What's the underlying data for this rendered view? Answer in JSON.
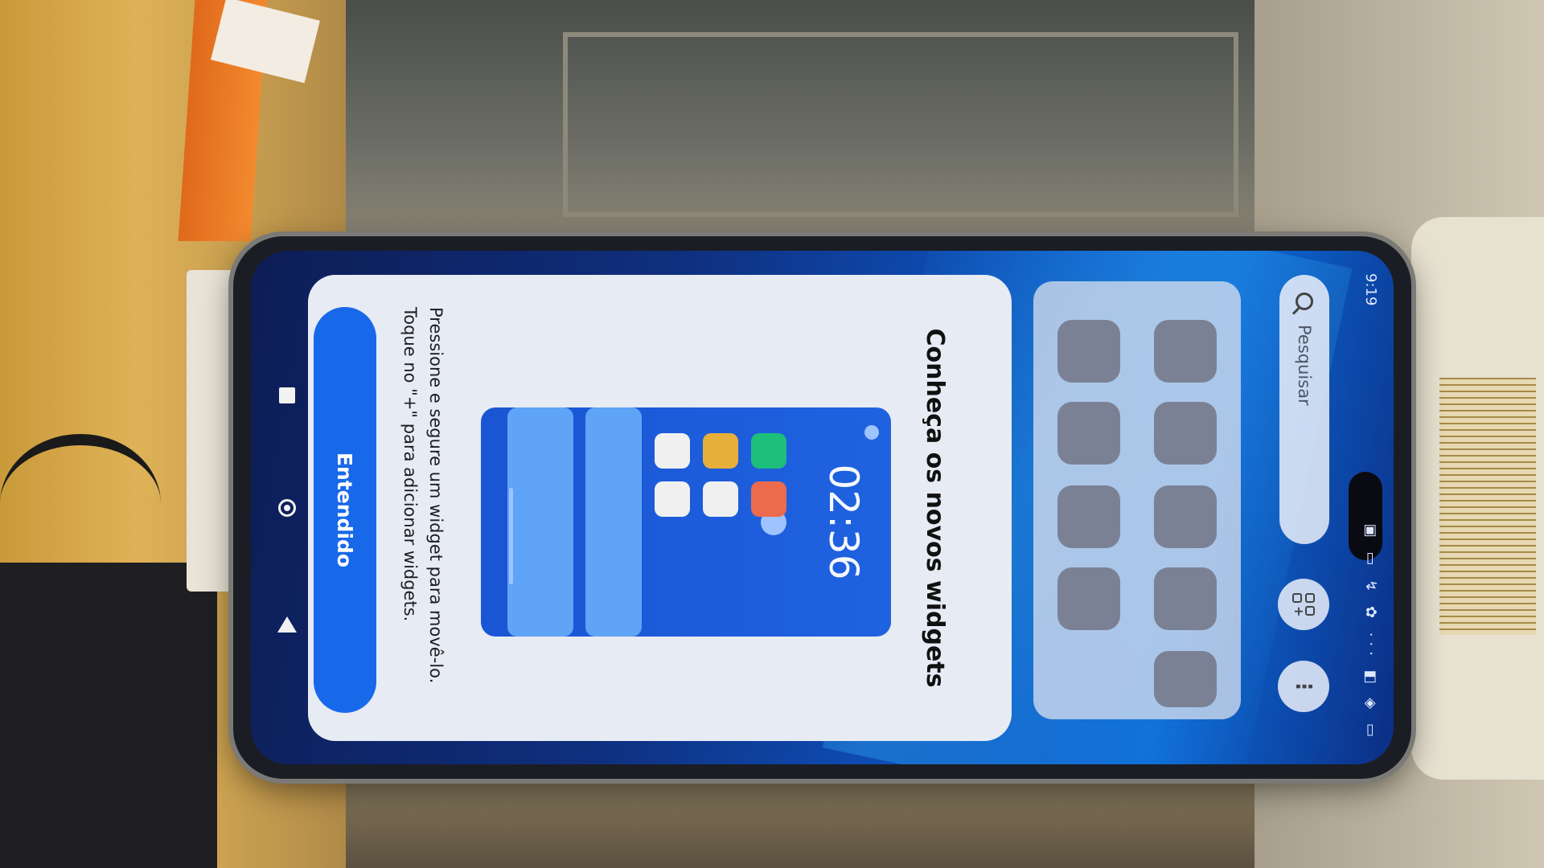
{
  "status_bar": {
    "time": "9:19",
    "icons": "▣ ▭ ↯ ✿ ··· ◧ ◈ ▭"
  },
  "launcher": {
    "search_placeholder": "Pesquisar",
    "widgets_button_icon": "widgets-grid-icon",
    "more_button_label": "⋮"
  },
  "dialog": {
    "title": "Conheça os novos widgets",
    "preview_time": "02:36",
    "description_line1": "Pressione e segure um widget para movê-lo.",
    "description_line2": "Toque no \"+\" para adicionar widgets.",
    "button_label": "Entendido"
  },
  "navigation": {
    "recents_icon": "recents-square-icon",
    "home_icon": "home-circle-icon",
    "back_icon": "back-triangle-icon"
  },
  "colors": {
    "accent_button": "#1868ea",
    "dialog_background": "#e7ebf3",
    "preview_background": "#1f62e0",
    "wallpaper_blue": "#0d4fb8"
  }
}
